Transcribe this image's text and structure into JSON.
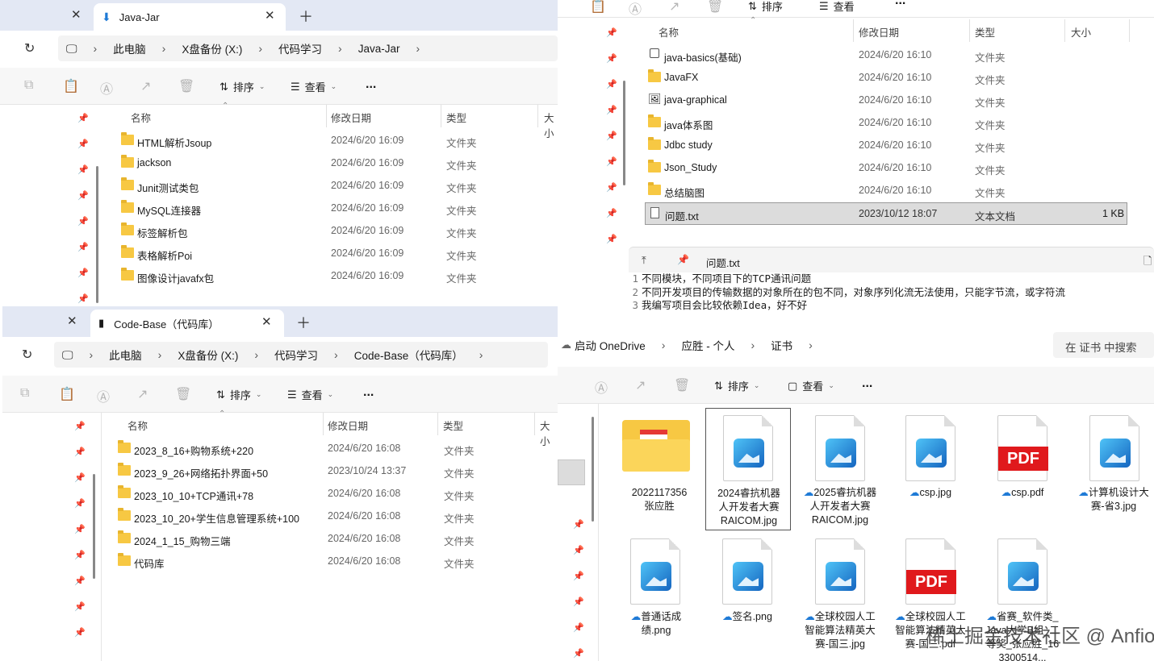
{
  "win1": {
    "tab_title": "Java-Jar",
    "crumbs": [
      "此电脑",
      "X盘备份 (X:)",
      "代码学习",
      "Java-Jar"
    ],
    "toolbar": {
      "sort": "排序",
      "view": "查看",
      "more": "..."
    },
    "columns": {
      "name": "名称",
      "date": "修改日期",
      "type": "类型",
      "size": "大小"
    },
    "rows": [
      {
        "name": "HTML解析Jsoup",
        "date": "2024/6/20 16:09",
        "type": "文件夹"
      },
      {
        "name": "jackson",
        "date": "2024/6/20 16:09",
        "type": "文件夹"
      },
      {
        "name": "Junit测试类包",
        "date": "2024/6/20 16:09",
        "type": "文件夹"
      },
      {
        "name": "MySQL连接器",
        "date": "2024/6/20 16:09",
        "type": "文件夹"
      },
      {
        "name": "标签解析包",
        "date": "2024/6/20 16:09",
        "type": "文件夹"
      },
      {
        "name": "表格解析Poi",
        "date": "2024/6/20 16:09",
        "type": "文件夹"
      },
      {
        "name": "图像设计javafx包",
        "date": "2024/6/20 16:09",
        "type": "文件夹"
      }
    ]
  },
  "win2": {
    "toolbar": {
      "sort": "排序",
      "view": "查看",
      "more": "..."
    },
    "columns": {
      "name": "名称",
      "date": "修改日期",
      "type": "类型",
      "size": "大小"
    },
    "rows": [
      {
        "name": "java-basics(基础)",
        "date": "2024/6/20 16:10",
        "type": "文件夹",
        "size": ""
      },
      {
        "name": "JavaFX",
        "date": "2024/6/20 16:10",
        "type": "文件夹",
        "size": ""
      },
      {
        "name": "java-graphical",
        "date": "2024/6/20 16:10",
        "type": "文件夹",
        "size": ""
      },
      {
        "name": "java体系图",
        "date": "2024/6/20 16:10",
        "type": "文件夹",
        "size": ""
      },
      {
        "name": "Jdbc study",
        "date": "2024/6/20 16:10",
        "type": "文件夹",
        "size": ""
      },
      {
        "name": "Json_Study",
        "date": "2024/6/20 16:10",
        "type": "文件夹",
        "size": ""
      },
      {
        "name": "总结脑图",
        "date": "2024/6/20 16:10",
        "type": "文件夹",
        "size": ""
      },
      {
        "name": "问题.txt",
        "date": "2023/10/12 18:07",
        "type": "文本文档",
        "size": "1 KB"
      }
    ],
    "preview": {
      "title": "问题.txt",
      "lines": [
        {
          "n": "1",
          "text": "不同模块，不同项目下的TCP通讯问题"
        },
        {
          "n": "2",
          "text": "不同开发项目的传输数据的对象所在的包不同，对象序列化流无法使用，只能字节流，或字符流"
        },
        {
          "n": "3",
          "text": "我编写项目会比较依赖Idea，好不好"
        }
      ]
    }
  },
  "win3": {
    "tab_title": "Code-Base（代码库）",
    "crumbs": [
      "此电脑",
      "X盘备份 (X:)",
      "代码学习",
      "Code-Base（代码库）"
    ],
    "toolbar": {
      "sort": "排序",
      "view": "查看",
      "more": "..."
    },
    "columns": {
      "name": "名称",
      "date": "修改日期",
      "type": "类型",
      "size": "大小"
    },
    "rows": [
      {
        "name": "2023_8_16+购物系统+220",
        "date": "2024/6/20 16:08",
        "type": "文件夹"
      },
      {
        "name": "2023_9_26+网络拓扑界面+50",
        "date": "2023/10/24 13:37",
        "type": "文件夹"
      },
      {
        "name": "2023_10_10+TCP通讯+78",
        "date": "2024/6/20 16:08",
        "type": "文件夹"
      },
      {
        "name": "2023_10_20+学生信息管理系统+100",
        "date": "2024/6/20 16:08",
        "type": "文件夹"
      },
      {
        "name": "2024_1_15_购物三端",
        "date": "2024/6/20 16:08",
        "type": "文件夹"
      },
      {
        "name": "代码库",
        "date": "2024/6/20 16:08",
        "type": "文件夹"
      }
    ]
  },
  "win4": {
    "crumbs": [
      "启动 OneDrive",
      "应胜 - 个人",
      "证书"
    ],
    "search_placeholder": "在 证书 中搜索",
    "toolbar": {
      "sort": "排序",
      "view": "查看",
      "more": "..."
    },
    "tiles": [
      {
        "label": "2022117356\n张应胜",
        "kind": "folder",
        "cloud": false
      },
      {
        "label": "2024睿抗机器人开发者大赛RAICOM.jpg",
        "kind": "image",
        "cloud": false
      },
      {
        "label": "2025睿抗机器人开发者大赛RAICOM.jpg",
        "kind": "image",
        "cloud": true
      },
      {
        "label": "csp.jpg",
        "kind": "image",
        "cloud": true
      },
      {
        "label": "csp.pdf",
        "kind": "pdf",
        "cloud": true
      },
      {
        "label": "计算机设计大赛-省3.jpg",
        "kind": "image",
        "cloud": true
      },
      {
        "label": "普通话成绩.png",
        "kind": "image",
        "cloud": true
      },
      {
        "label": "签名.png",
        "kind": "image",
        "cloud": true
      },
      {
        "label": "全球校园人工智能算法精英大赛-国三.jpg",
        "kind": "image",
        "cloud": true
      },
      {
        "label": "全球校园人工智能算法精英大赛-国三.pdf",
        "kind": "pdf",
        "cloud": true
      },
      {
        "label": "省赛_软件类_Java大学B组_二等奖_张应胜_163300514...",
        "kind": "image",
        "cloud": true
      }
    ]
  },
  "watermark": "稀土掘金技术社区 @ Anfioo"
}
